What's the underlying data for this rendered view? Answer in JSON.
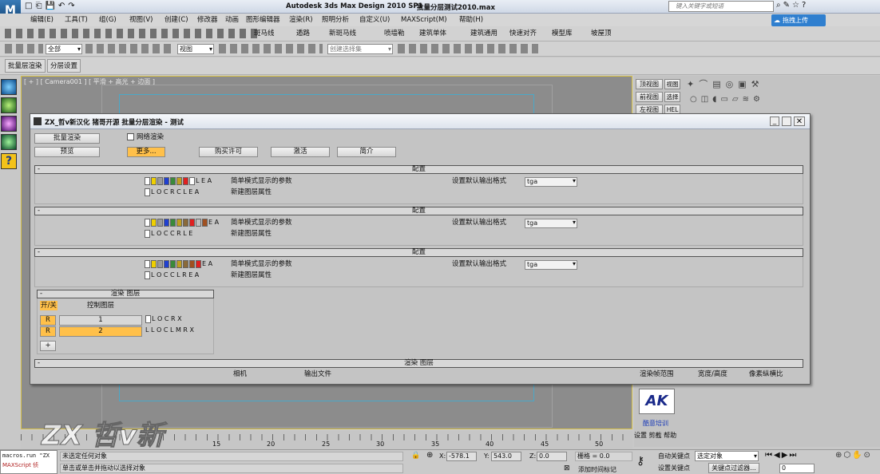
{
  "window": {
    "title": "Autodesk 3ds Max Design 2010 SP1",
    "file": "批量分层测试2010.max",
    "search_placeholder": "键入关键字或短语",
    "upload_label": "拖拽上传"
  },
  "menu": [
    "编辑(E)",
    "工具(T)",
    "组(G)",
    "视图(V)",
    "创建(C)",
    "修改器",
    "动画",
    "图形编辑器",
    "渲染(R)",
    "照明分析",
    "自定义(U)",
    "MAXScript(M)",
    "帮助(H)"
  ],
  "toolbar1": {
    "labels": [
      "斑马线",
      "遁路",
      "新斑马线",
      "喷墙勒",
      "建筑单体",
      "建筑通用",
      "快速对齐",
      "模型库",
      "坡屋顶"
    ]
  },
  "toolbar2": {
    "filter": "全部",
    "ref_coord": "视图",
    "named_sel": "创建选择集"
  },
  "toolbar3": {
    "tabs": [
      "批量层渲染",
      "分层设置"
    ]
  },
  "viewport": {
    "label": "[ + ] [ Camera001 ] [ 平滑 + 高光 + 边面 ]"
  },
  "cmdpanel": {
    "view_buttons": [
      "顶视图",
      "前视图",
      "左视图"
    ],
    "side_buttons": [
      "视图",
      "选择",
      "HEL"
    ],
    "logo_text": "AK",
    "logo_caption": "酷意培训",
    "footer": "设置 剪截 帮助"
  },
  "dialog": {
    "title": "ZX_哲v新汉化 猪哥开源 批量分层渲染 - 测试",
    "buttons": {
      "batch_render": "批量渲染",
      "preview": "预览",
      "more": "更多...",
      "buy": "购买许可",
      "activate": "激活",
      "intro": "简介"
    },
    "network_render": "网络渲染",
    "config_sections": [
      {
        "title": "配置",
        "row1_letters": "L E A",
        "row2_letters": "L O C  R  C L E A",
        "row1_label": "简单模式显示的参数",
        "row2_label": "新建图层属性",
        "format_label": "设置默认输出格式",
        "format_value": "tga"
      },
      {
        "title": "配置",
        "row1_letters": "E A",
        "row2_letters": "L O C C  R  L E",
        "row1_label": "简单模式显示的参数",
        "row2_label": "新建图层属性",
        "format_label": "设置默认输出格式",
        "format_value": "tga"
      },
      {
        "title": "配置",
        "row1_letters": "E A",
        "row2_letters": "L O C C  L  R  E A",
        "row1_label": "简单模式显示的参数",
        "row2_label": "新建图层属性",
        "format_label": "设置默认输出格式",
        "format_value": "tga"
      }
    ],
    "render_layers": {
      "title": "渲染 图层",
      "col_onoff": "开/关",
      "col_control": "控制图层",
      "rows": [
        {
          "flag": "R",
          "index": "1",
          "letters": "L O C  R  X"
        },
        {
          "flag": "R",
          "index": "2",
          "letters": "L L O C L M R  X"
        }
      ],
      "add": "+"
    },
    "bottom_section": {
      "title": "渲染 图层",
      "cols": [
        "相机",
        "输出文件",
        "渲染帧范围",
        "宽度/高度",
        "像素纵横比"
      ]
    }
  },
  "timeline": {
    "ticks": [
      "15",
      "20",
      "25",
      "30",
      "35",
      "40",
      "45",
      "50"
    ]
  },
  "status": {
    "maxscript_title": "macros.run \"ZX",
    "maxscript_label": "MAXScript 侦",
    "line1": "未选定任何对象",
    "line2": "单击或单击并拖动以选择对象",
    "x_label": "X:",
    "x_value": "-578.1",
    "y_label": "Y:",
    "y_value": "543.0",
    "z_label": "Z:",
    "z_value": "0.0",
    "grid": "栅格 = 0.0",
    "add_time_tag": "添加时间标记",
    "autokey": "自动关键点",
    "setkey": "设置关键点",
    "selected": "选定对象",
    "key_filters": "关键点过滤器...",
    "frame": "0"
  },
  "watermark": "ZX 哲v新",
  "colors": {
    "accent": "#ffc04a",
    "title_blue": "#2a4f8c"
  }
}
